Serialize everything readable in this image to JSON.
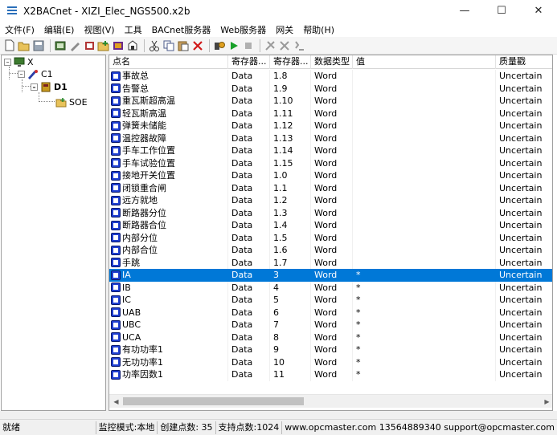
{
  "window": {
    "title": "X2BACnet - XIZI_Elec_NGS500.x2b"
  },
  "menu": [
    "文件(F)",
    "编辑(E)",
    "视图(V)",
    "工具",
    "BACnet服务器",
    "Web服务器",
    "网关",
    "帮助(H)"
  ],
  "tree": {
    "root": "X",
    "channel": "C1",
    "device": "D1",
    "group": "SOE"
  },
  "table": {
    "columns": [
      "点名",
      "寄存器...",
      "寄存器...",
      "数据类型",
      "值",
      "质量戳"
    ],
    "rows": [
      [
        "事故总",
        "Data",
        "1.8",
        "Word",
        "",
        "Uncertain"
      ],
      [
        "告警总",
        "Data",
        "1.9",
        "Word",
        "",
        "Uncertain"
      ],
      [
        "重瓦斯超高温",
        "Data",
        "1.10",
        "Word",
        "",
        "Uncertain"
      ],
      [
        "轻瓦斯高温",
        "Data",
        "1.11",
        "Word",
        "",
        "Uncertain"
      ],
      [
        "弹簧未储能",
        "Data",
        "1.12",
        "Word",
        "",
        "Uncertain"
      ],
      [
        "温控器故障",
        "Data",
        "1.13",
        "Word",
        "",
        "Uncertain"
      ],
      [
        "手车工作位置",
        "Data",
        "1.14",
        "Word",
        "",
        "Uncertain"
      ],
      [
        "手车试验位置",
        "Data",
        "1.15",
        "Word",
        "",
        "Uncertain"
      ],
      [
        "接地开关位置",
        "Data",
        "1.0",
        "Word",
        "",
        "Uncertain"
      ],
      [
        "闭锁重合闸",
        "Data",
        "1.1",
        "Word",
        "",
        "Uncertain"
      ],
      [
        "远方就地",
        "Data",
        "1.2",
        "Word",
        "",
        "Uncertain"
      ],
      [
        "断路器分位",
        "Data",
        "1.3",
        "Word",
        "",
        "Uncertain"
      ],
      [
        "断路器合位",
        "Data",
        "1.4",
        "Word",
        "",
        "Uncertain"
      ],
      [
        "内部分位",
        "Data",
        "1.5",
        "Word",
        "",
        "Uncertain"
      ],
      [
        "内部合位",
        "Data",
        "1.6",
        "Word",
        "",
        "Uncertain"
      ],
      [
        "手跳",
        "Data",
        "1.7",
        "Word",
        "",
        "Uncertain"
      ],
      [
        "IA",
        "Data",
        "3",
        "Word",
        "*",
        "Uncertain"
      ],
      [
        "IB",
        "Data",
        "4",
        "Word",
        "*",
        "Uncertain"
      ],
      [
        "IC",
        "Data",
        "5",
        "Word",
        "*",
        "Uncertain"
      ],
      [
        "UAB",
        "Data",
        "6",
        "Word",
        "*",
        "Uncertain"
      ],
      [
        "UBC",
        "Data",
        "7",
        "Word",
        "*",
        "Uncertain"
      ],
      [
        "UCA",
        "Data",
        "8",
        "Word",
        "*",
        "Uncertain"
      ],
      [
        "有功功率1",
        "Data",
        "9",
        "Word",
        "*",
        "Uncertain"
      ],
      [
        "无功功率1",
        "Data",
        "10",
        "Word",
        "*",
        "Uncertain"
      ],
      [
        "功率因数1",
        "Data",
        "11",
        "Word",
        "*",
        "Uncertain"
      ]
    ],
    "selected_row": 16
  },
  "status": {
    "ready": "就绪",
    "mode": "监控模式:本地",
    "created": "创建点数: 35",
    "supported": "支持点数:1024",
    "contact": "www.opcmaster.com 13564889340 support@opcmaster.com"
  },
  "colors": {
    "selection": "#0078d7",
    "tag_icon": "#1f3fd1"
  }
}
